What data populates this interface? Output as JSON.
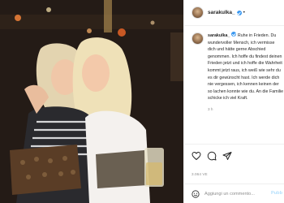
{
  "post": {
    "username": "sarakulka_",
    "header_follow_dot": "•",
    "caption_lines": [
      "Ruhe in Frieden. Du",
      "wundervoller Mensch, ich vermisse",
      "dich und hätte gerne Abschied",
      "genommen. Ich hoffe du findest deinen",
      "Frieden jetzt und ich hoffe die Wahrheit",
      "kommt jetzt raus, ich weiß wie sehr du",
      "es dir gewünscht hast. Ich werde dich",
      "nie vergessen, ich kennen keinen der",
      "so lachen konnte wie du. An die Familie",
      "schicke ich viel Kraft."
    ],
    "time_ago": "3 h",
    "likes_count": "3.064 VE",
    "comment_placeholder": "Aggiungi un commento...",
    "publish_label": "Pubb"
  },
  "icons": {
    "header_avatar": "avatar-icon",
    "caption_avatar": "avatar-icon",
    "like": "heart-icon",
    "comment": "comment-icon",
    "share": "paper-plane-icon",
    "emoji": "smiley-icon"
  },
  "colors": {
    "verified": "#3897f0",
    "publish": "#b2dffc",
    "text_muted": "#8e8e8e",
    "text_main": "#262626"
  }
}
